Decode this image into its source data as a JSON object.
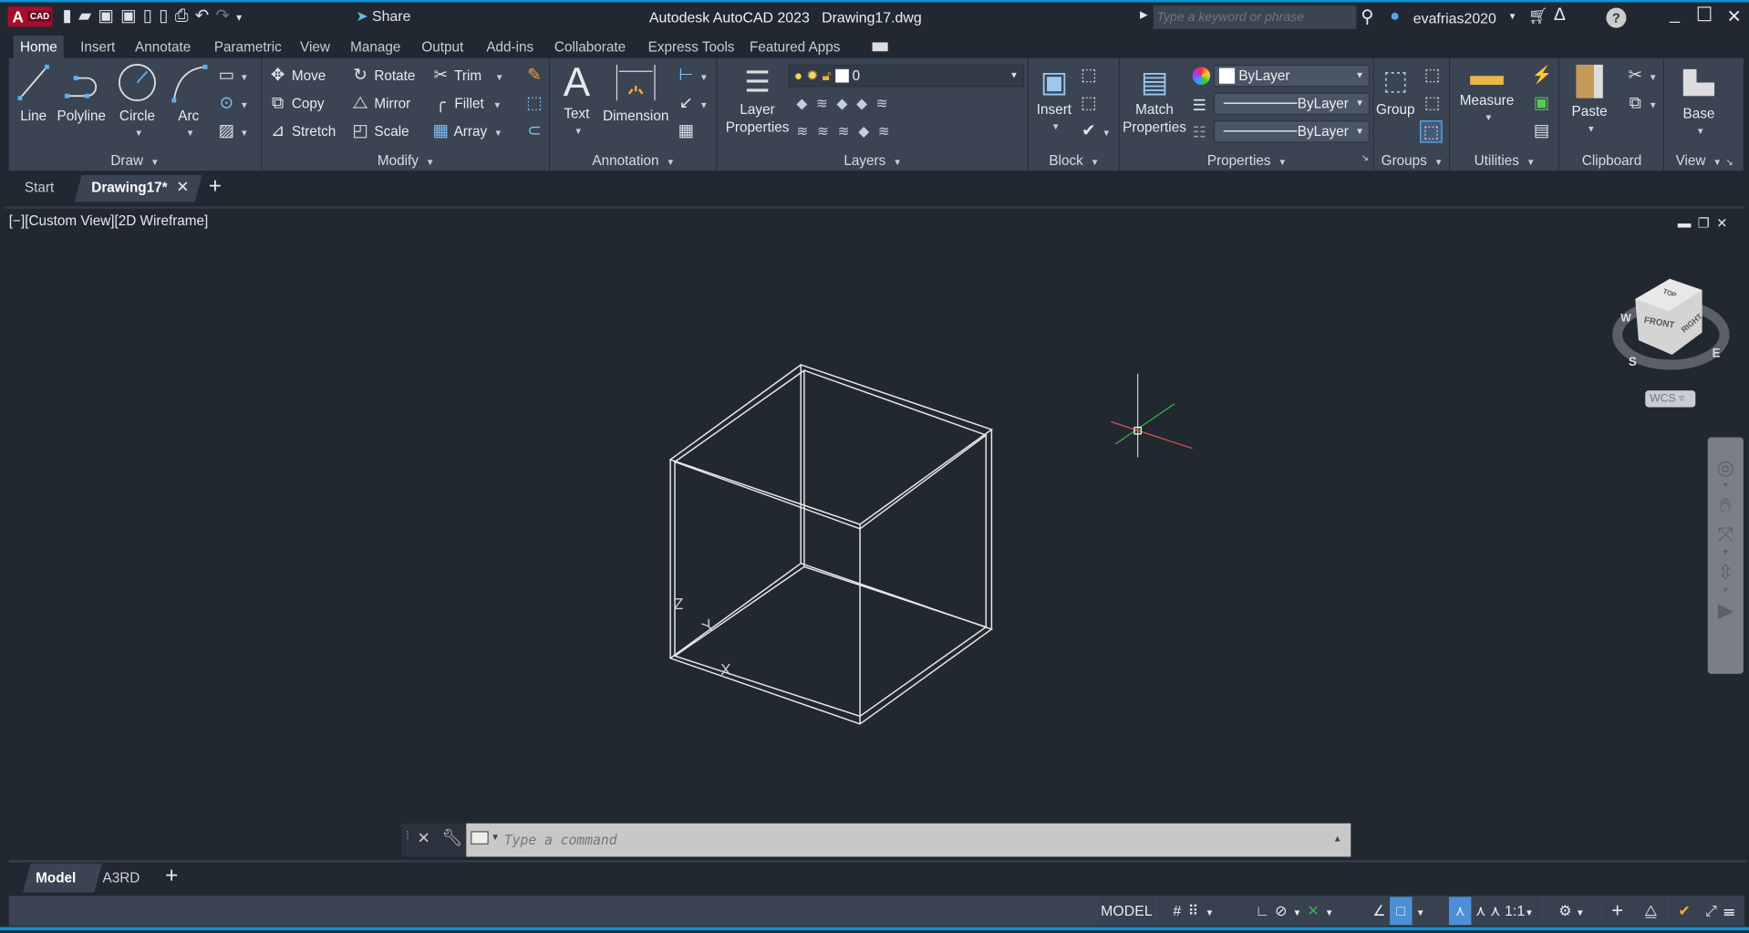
{
  "app": {
    "logo": "A",
    "logo_sub": "CAD",
    "title": "Autodesk AutoCAD 2023",
    "file": "Drawing17.dwg",
    "share": "Share",
    "search_placeholder": "Type a keyword or phrase",
    "user": "evafrias2020"
  },
  "ribbon_tabs": [
    "Home",
    "Insert",
    "Annotate",
    "Parametric",
    "View",
    "Manage",
    "Output",
    "Add-ins",
    "Collaborate",
    "Express Tools",
    "Featured Apps"
  ],
  "panels": {
    "draw": {
      "label": "Draw",
      "line": "Line",
      "polyline": "Polyline",
      "circle": "Circle",
      "arc": "Arc"
    },
    "modify": {
      "label": "Modify",
      "move": "Move",
      "copy": "Copy",
      "stretch": "Stretch",
      "rotate": "Rotate",
      "mirror": "Mirror",
      "scale": "Scale",
      "trim": "Trim",
      "fillet": "Fillet",
      "array": "Array"
    },
    "annotation": {
      "label": "Annotation",
      "text": "Text",
      "dimension": "Dimension"
    },
    "layers": {
      "label": "Layers",
      "layer_properties_1": "Layer",
      "layer_properties_2": "Properties",
      "current_layer": "0"
    },
    "block": {
      "label": "Block",
      "insert": "Insert"
    },
    "properties": {
      "label": "Properties",
      "match_1": "Match",
      "match_2": "Properties",
      "color": "ByLayer",
      "linetype": "ByLayer",
      "lineweight": "ByLayer"
    },
    "groups": {
      "label": "Groups",
      "group": "Group"
    },
    "utilities": {
      "label": "Utilities",
      "measure": "Measure"
    },
    "clipboard": {
      "label": "Clipboard",
      "paste": "Paste"
    },
    "view": {
      "label": "View",
      "base": "Base"
    }
  },
  "doc_tabs": {
    "start": "Start",
    "active": "Drawing17*"
  },
  "viewport": {
    "label": "[−][Custom View][2D Wireframe]",
    "axis_x": "X",
    "axis_y": "Y",
    "axis_z": "Z"
  },
  "viewcube": {
    "top": "TOP",
    "front": "FRONT",
    "right": "RIGHT",
    "n": "W",
    "s": "S",
    "e": "E",
    "ucs": "WCS"
  },
  "command": {
    "placeholder": "Type a command"
  },
  "layout_tabs": [
    "Model",
    "A3RD"
  ],
  "status": {
    "model": "MODEL",
    "scale": "1:1"
  },
  "colors": {
    "accent": "#0696d7",
    "ribbon": "#3b4453",
    "canvas": "#212830"
  }
}
